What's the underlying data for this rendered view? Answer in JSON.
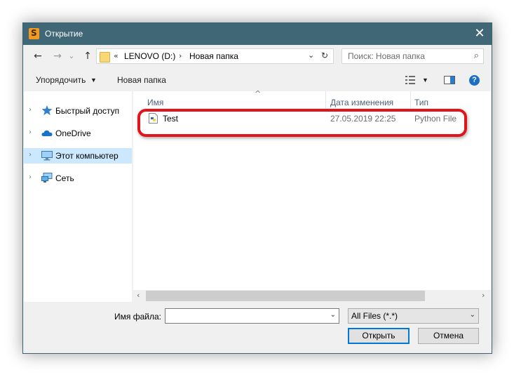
{
  "window": {
    "title": "Открытие",
    "close_glyph": "✕"
  },
  "nav": {
    "back": "←",
    "forward": "→",
    "recent": "⌄",
    "up": "↑",
    "address": {
      "overflow": "«",
      "segments": [
        "LENOVO (D:)",
        "Новая папка"
      ],
      "separator": "›",
      "dropdown": "⌄",
      "refresh": "↻"
    },
    "search": {
      "placeholder": "Поиск: Новая папка",
      "icon": "⌕"
    }
  },
  "toolbar": {
    "organize": "Упорядочить",
    "organize_caret": "▼",
    "new_folder": "Новая папка",
    "view_caret": "▼",
    "help": "?"
  },
  "sidebar": {
    "items": [
      {
        "label": "Быстрый доступ",
        "icon": "star-icon",
        "selected": false
      },
      {
        "label": "OneDrive",
        "icon": "cloud-icon",
        "selected": false
      },
      {
        "label": "Этот компьютер",
        "icon": "computer-icon",
        "selected": true
      },
      {
        "label": "Сеть",
        "icon": "network-icon",
        "selected": false
      }
    ],
    "chevron": "›"
  },
  "files": {
    "columns": {
      "name": "Имя",
      "modified": "Дата изменения",
      "type": "Тип"
    },
    "sort_indicator": "^",
    "rows": [
      {
        "name": "Test",
        "modified": "27.05.2019 22:25",
        "type": "Python File",
        "icon": "python-file-icon"
      }
    ]
  },
  "scroll": {
    "left": "‹",
    "right": "›"
  },
  "bottom": {
    "filename_label": "Имя файла:",
    "filename_value": "",
    "filename_drop": "⌄",
    "filetype": "All Files (*.*)",
    "filetype_drop": "⌄",
    "open_button": "Открыть",
    "cancel_button": "Отмена"
  },
  "colors": {
    "titlebar": "#3f6776",
    "selection": "#cce8ff",
    "highlight": "#e0141a",
    "accent": "#0078d7"
  }
}
